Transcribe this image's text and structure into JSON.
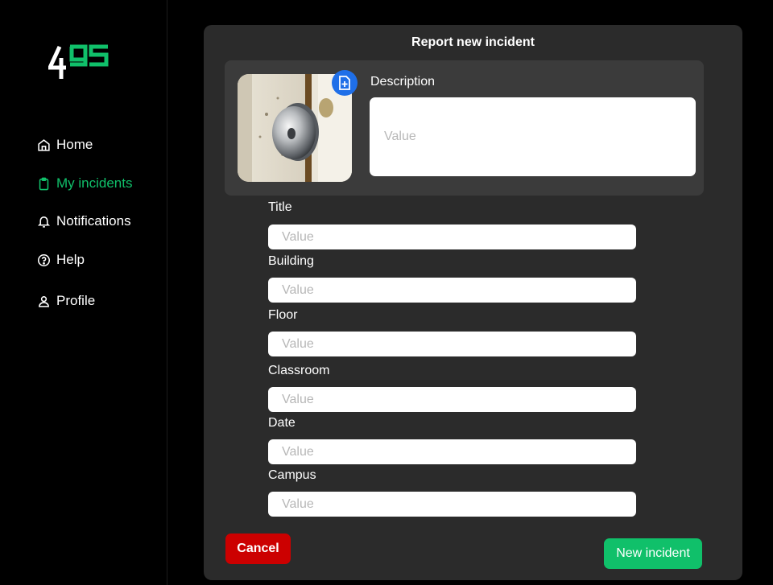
{
  "brand": {
    "logo_text": "495",
    "accent_color": "#10c06a",
    "logo_color": "#ffffff"
  },
  "sidebar": {
    "items": [
      {
        "label": "Home",
        "icon": "home-icon",
        "active": false
      },
      {
        "label": "My incidents",
        "icon": "clipboard-icon",
        "active": true
      },
      {
        "label": "Notifications",
        "icon": "bell-icon",
        "active": false
      },
      {
        "label": "Help",
        "icon": "help-circle-icon",
        "active": false
      },
      {
        "label": "Profile",
        "icon": "user-icon",
        "active": false
      }
    ]
  },
  "form": {
    "title": "Report new incident",
    "photo": {
      "subject": "door knob",
      "add_icon": "add-file-icon"
    },
    "description": {
      "label": "Description",
      "placeholder": "Value"
    },
    "fields": [
      {
        "label": "Title",
        "placeholder": "Value"
      },
      {
        "label": "Building",
        "placeholder": "Value"
      },
      {
        "label": "Floor",
        "placeholder": "Value"
      },
      {
        "label": "Classroom",
        "placeholder": "Value"
      },
      {
        "label": "Date",
        "placeholder": "Value"
      },
      {
        "label": "Campus",
        "placeholder": "Value"
      }
    ],
    "cancel_label": "Cancel",
    "submit_label": "New incident",
    "colors": {
      "cancel": "#cc0000",
      "submit": "#10c06a",
      "add_icon_bg": "#1f6fe8"
    }
  }
}
